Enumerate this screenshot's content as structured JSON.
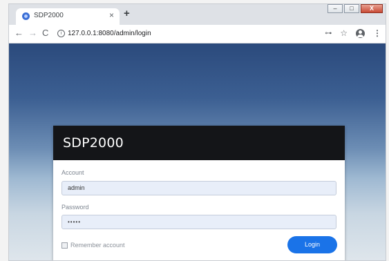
{
  "browser": {
    "tab_title": "SDP2000",
    "tab_close": "×",
    "new_tab": "+",
    "url": "127.0.0.1:8080/admin/login",
    "window_controls": {
      "minimize": "–",
      "maximize": "□",
      "close": "X"
    },
    "icons": {
      "back": "arrow-left",
      "forward": "arrow-right",
      "reload": "reload",
      "info": "info",
      "key": "key",
      "bookmark": "star",
      "account": "account",
      "menu": "kebab"
    }
  },
  "login": {
    "title": "SDP2000",
    "account_label": "Account",
    "account_value": "admin",
    "password_label": "Password",
    "password_value": "•••••",
    "remember_label": "Remember account",
    "remember_checked": false,
    "login_button": "Login"
  },
  "colors": {
    "header_bg": "#141518",
    "accent": "#1a73e8",
    "input_bg": "#e8eef9"
  }
}
